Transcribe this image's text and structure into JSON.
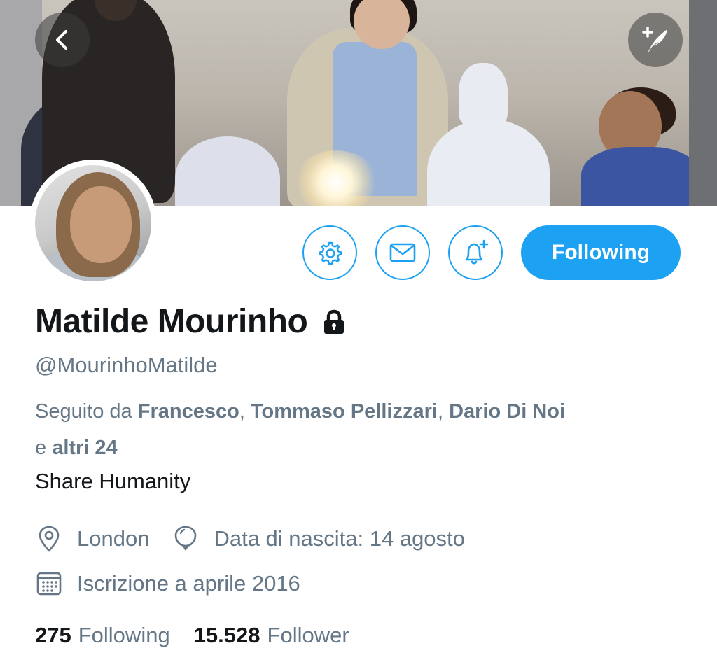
{
  "header": {
    "back_icon": "chevron-left-icon",
    "compose_icon": "compose-quill-icon"
  },
  "profile": {
    "name": "Matilde Mourinho",
    "protected_icon": "lock-icon",
    "handle": "@MourinhoMatilde",
    "followed_by_prefix": "Seguito da ",
    "followed_by_names": [
      "Francesco",
      "Tommaso Pellizzari",
      "Dario Di Noi"
    ],
    "followed_by_sep": ", ",
    "followed_by_and": " e ",
    "followed_by_others": "altri 24",
    "bio": "Share Humanity",
    "location": "London",
    "birthday": "Data di nascita: 14 agosto",
    "joined": "Iscrizione a aprile 2016"
  },
  "actions": {
    "settings_icon": "gear-icon",
    "message_icon": "envelope-icon",
    "notify_icon": "bell-plus-icon",
    "follow_label": "Following"
  },
  "stats": {
    "following_count": "275",
    "following_label": "Following",
    "followers_count": "15.528",
    "followers_label": "Follower"
  },
  "colors": {
    "accent": "#1da1f2",
    "text_primary": "#14171a",
    "text_secondary": "#657786"
  }
}
